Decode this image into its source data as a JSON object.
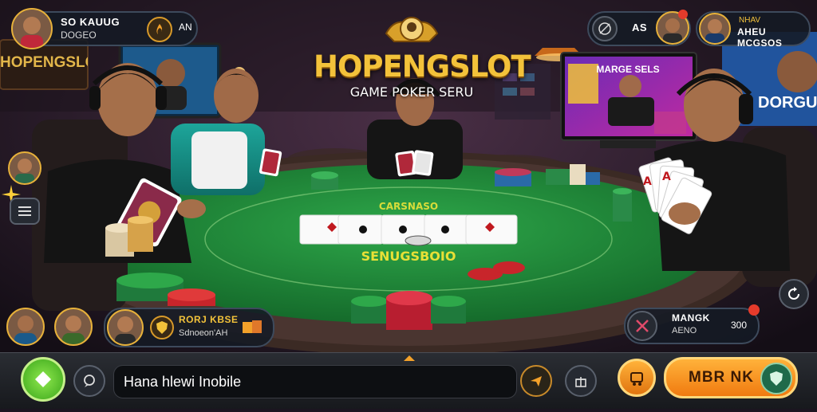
{
  "branding": {
    "title": "HOPENGSLOT",
    "subtitle": "GAME POKER SERU"
  },
  "background": {
    "left_sign": "HOPENGSLOT",
    "tv_left_text": "",
    "tv_center_text": "MARGE SELS",
    "tv_right_text": "DORGU"
  },
  "table": {
    "top_text": "CARSNASO",
    "main_text": "SENUGSBOIO",
    "felt_color": "#1f8a3a",
    "rail_color": "#3a2a22"
  },
  "players": {
    "top_left": {
      "name": "SO KAUUG",
      "sub": "DOGEO",
      "badge": "AN"
    },
    "top_right": {
      "name": "NHAV",
      "sub": "AHEU MCGSOS"
    },
    "bottom_left": {
      "name": "RORJ KBSE",
      "sub": "Sdnoeon'AH"
    },
    "bottom_right": {
      "name": "MANGK",
      "sub": "AENO",
      "value": "300"
    }
  },
  "top_right_icons": {
    "code_label": "AS"
  },
  "bottom_bar": {
    "chat_placeholder": "Hana hlewi Inobile",
    "play_label": "MBR NK"
  },
  "colors": {
    "accent_gold": "#f3c23a",
    "play_orange": "#f59a22",
    "green_button": "#5ec92e"
  },
  "icons": [
    "sparkle-icon",
    "menu-icon",
    "shield-icon",
    "chat-icon",
    "send-icon",
    "gift-icon",
    "cart-icon",
    "refresh-icon",
    "crossbow-icon",
    "swords-icon",
    "chips-icon",
    "flame-icon"
  ]
}
